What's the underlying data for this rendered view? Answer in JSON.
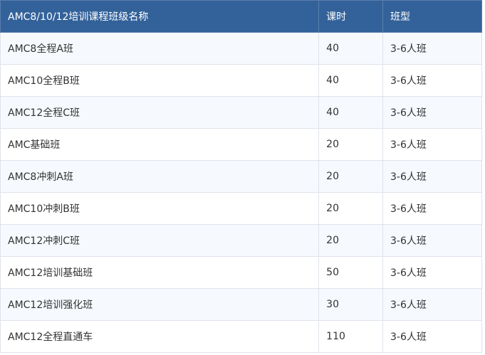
{
  "table": {
    "headers": [
      "AMC8/10/12培训课程班级名称",
      "课时",
      "班型"
    ],
    "rows": [
      [
        "AMC8全程A班",
        "40",
        "3-6人班"
      ],
      [
        "AMC10全程B班",
        "40",
        "3-6人班"
      ],
      [
        "AMC12全程C班",
        "40",
        "3-6人班"
      ],
      [
        "AMC基础班",
        "20",
        "3-6人班"
      ],
      [
        "AMC8冲刺A班",
        "20",
        "3-6人班"
      ],
      [
        "AMC10冲刺B班",
        "20",
        "3-6人班"
      ],
      [
        "AMC12冲刺C班",
        "20",
        "3-6人班"
      ],
      [
        "AMC12培训基础班",
        "50",
        "3-6人班"
      ],
      [
        "AMC12培训强化班",
        "30",
        "3-6人班"
      ],
      [
        "AMC12全程直通车",
        "110",
        "3-6人班"
      ]
    ]
  },
  "colors": {
    "header_bg": "#33629a",
    "header_text": "#ffffff",
    "row_odd_bg": "#f6f9fd",
    "row_even_bg": "#ffffff",
    "border": "#dfe3ea",
    "body_text": "#333333"
  }
}
